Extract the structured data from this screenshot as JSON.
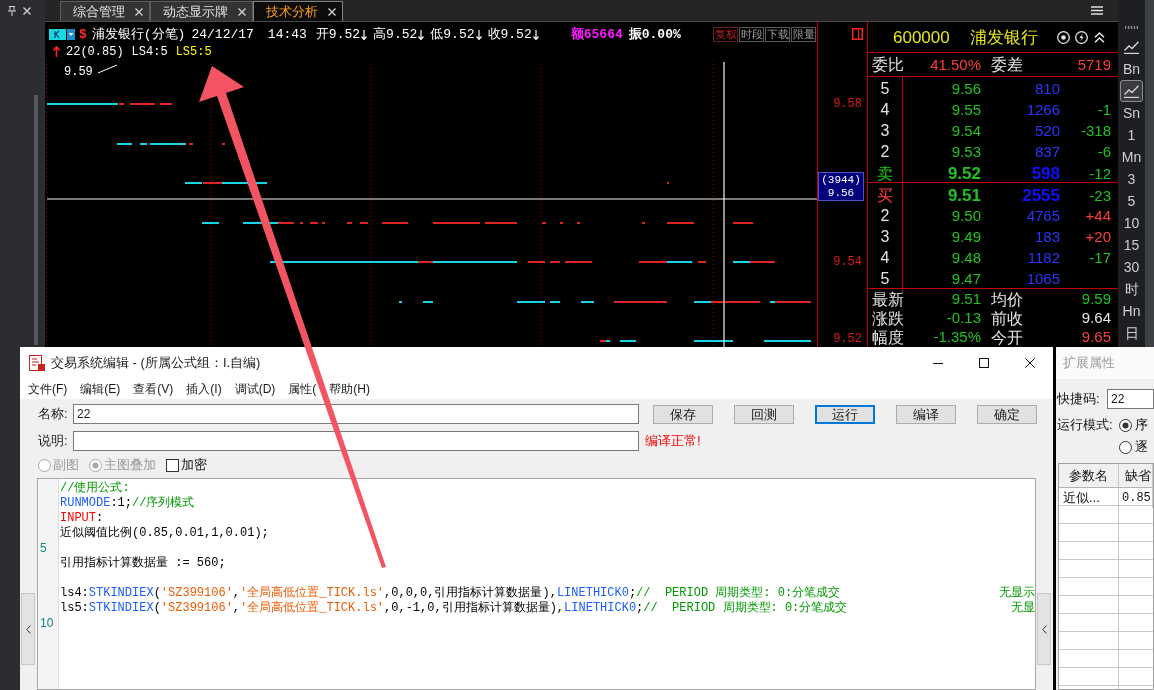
{
  "top_bar": {
    "tabs": [
      {
        "label": "综合管理",
        "selected": false
      },
      {
        "label": "动态显示牌",
        "selected": false
      },
      {
        "label": "技术分析",
        "selected": true
      }
    ]
  },
  "chart": {
    "header": {
      "currency_mark": "$",
      "title": "浦发银行(分笔)",
      "date": "24/12/17",
      "time": "14:43",
      "quotes": [
        {
          "label": "开",
          "value": "9.52"
        },
        {
          "label": "高",
          "value": "9.52"
        },
        {
          "label": "低",
          "value": "9.52"
        },
        {
          "label": "收",
          "value": "9.52"
        }
      ],
      "amount": "额65664",
      "amplitude": "振0.00%",
      "buttons": [
        {
          "label": "复权",
          "selected": true
        },
        {
          "label": "时段",
          "selected": false
        },
        {
          "label": "下载",
          "selected": false
        },
        {
          "label": "限量",
          "selected": false
        }
      ]
    },
    "indicators": [
      {
        "text": "22(0.85)",
        "color": "#ffffff"
      },
      {
        "text": "LS4:5",
        "color": "#ffffff"
      },
      {
        "text": "LS5:5",
        "color": "#ffff00"
      }
    ],
    "top_price": "9.59",
    "axis_labels": [
      "9.58",
      "9.54",
      "9.52"
    ],
    "cursor": {
      "count": "(3944)",
      "price": "9.56"
    }
  },
  "quote_panel": {
    "code": "600000",
    "name": "浦发银行",
    "ratio_label": "委比",
    "ratio": "41.50%",
    "diff_label": "委差",
    "diff": "5719",
    "asks": [
      {
        "level": "5",
        "price": "9.56",
        "volume": "810",
        "best": false
      },
      {
        "level": "4",
        "price": "9.55",
        "volume": "1266",
        "change": "-1",
        "rising": false,
        "best": false
      },
      {
        "level": "3",
        "price": "9.54",
        "volume": "520",
        "change": "-318",
        "rising": false,
        "best": false
      },
      {
        "level": "2",
        "price": "9.53",
        "volume": "837",
        "change": "-6",
        "rising": false,
        "best": false
      },
      {
        "level": "卖",
        "price": "9.52",
        "volume": "598",
        "change": "-12",
        "rising": false,
        "best": true
      }
    ],
    "bids": [
      {
        "level": "买",
        "price": "9.51",
        "volume": "2555",
        "change": "-23",
        "rising": false,
        "best": true
      },
      {
        "level": "2",
        "price": "9.50",
        "volume": "4765",
        "change": "+44",
        "rising": true,
        "best": false
      },
      {
        "level": "3",
        "price": "9.49",
        "volume": "183",
        "change": "+20",
        "rising": true,
        "best": false
      },
      {
        "level": "4",
        "price": "9.48",
        "volume": "1182",
        "change": "-17",
        "rising": false,
        "best": false
      },
      {
        "level": "5",
        "price": "9.47",
        "volume": "1065",
        "best": false
      }
    ],
    "stats": [
      {
        "label": "最新",
        "value": "9.51",
        "color": "#1fc41f"
      },
      {
        "label": "均价",
        "value": "9.59",
        "color": "#1fc41f"
      },
      {
        "label": "涨跌",
        "value": "-0.13",
        "color": "#1fc41f"
      },
      {
        "label": "前收",
        "value": "9.64",
        "color": "#e4e4e4"
      },
      {
        "label": "幅度",
        "value": "-1.35%",
        "color": "#1fc41f"
      },
      {
        "label": "今开",
        "value": "9.65",
        "color": "#ff3c3c"
      }
    ]
  },
  "period_toolbar": {
    "items": [
      {
        "kind": "icon",
        "selected": false
      },
      {
        "kind": "text",
        "label": "Bn",
        "selected": false
      },
      {
        "kind": "icon",
        "selected": true
      },
      {
        "kind": "text",
        "label": "Sn",
        "selected": false
      },
      {
        "kind": "text",
        "label": "1",
        "selected": false
      },
      {
        "kind": "text",
        "label": "Mn",
        "selected": false
      },
      {
        "kind": "text",
        "label": "3",
        "selected": false
      },
      {
        "kind": "text",
        "label": "5",
        "selected": false
      },
      {
        "kind": "text",
        "label": "10",
        "selected": false
      },
      {
        "kind": "text",
        "label": "15",
        "selected": false
      },
      {
        "kind": "text",
        "label": "30",
        "selected": false
      },
      {
        "kind": "text",
        "label": "时",
        "selected": false
      },
      {
        "kind": "text",
        "label": "Hn",
        "selected": false
      },
      {
        "kind": "text",
        "label": "日",
        "selected": false
      }
    ]
  },
  "formula_editor": {
    "title": "交易系统编辑 - (所属公式组：I.自编)",
    "menu": [
      "文件(F)",
      "编辑(E)",
      "查看(V)",
      "插入(I)",
      "调试(D)",
      "属性(",
      "帮助(H)"
    ],
    "name_label": "名称:",
    "name_value": "22",
    "desc_label": "说明:",
    "buttons": [
      {
        "label": "保存",
        "focused": false
      },
      {
        "label": "回测",
        "focused": false
      },
      {
        "label": "运行",
        "focused": true
      },
      {
        "label": "编译",
        "focused": false
      },
      {
        "label": "确定",
        "focused": false
      }
    ],
    "status": "编译正常!",
    "options": [
      {
        "kind": "radio",
        "label": "副图",
        "selected": false,
        "disabled": true
      },
      {
        "kind": "radio",
        "label": "主图叠加",
        "selected": true,
        "disabled": true
      },
      {
        "kind": "checkbox",
        "label": "加密",
        "checked": false,
        "disabled": false
      }
    ],
    "code_lines": [
      {
        "kind": "code",
        "tokens": [
          {
            "kind": "comment",
            "text": "//使用公式:"
          }
        ]
      },
      {
        "kind": "code",
        "tokens": [
          {
            "kind": "keyword",
            "text": "RUNMODE"
          },
          {
            "kind": "text",
            "text": ":1;"
          },
          {
            "kind": "comment",
            "text": "//序列模式"
          }
        ]
      },
      {
        "kind": "code",
        "tokens": [
          {
            "kind": "declaration",
            "text": "INPUT"
          },
          {
            "kind": "text",
            "text": ":"
          }
        ]
      },
      {
        "kind": "code",
        "tokens": [
          {
            "kind": "text",
            "text": "近似阈值比例(0.85,0.01,1,0.01);"
          }
        ]
      },
      {
        "kind": "blank",
        "number": "5"
      },
      {
        "kind": "code",
        "tokens": [
          {
            "kind": "text",
            "text": "引用指标计算数据量 := 560;"
          }
        ]
      },
      {
        "kind": "blank"
      },
      {
        "kind": "code",
        "tokens": [
          {
            "kind": "text",
            "text": "ls4:"
          },
          {
            "kind": "keyword",
            "text": "STKINDIEX"
          },
          {
            "kind": "text",
            "text": "("
          },
          {
            "kind": "string",
            "text": "'SZ399106'"
          },
          {
            "kind": "text",
            "text": ","
          },
          {
            "kind": "string",
            "text": "'全局高低位置_TICK.ls'"
          },
          {
            "kind": "text",
            "text": ",0,0,0,引用指标计算数据量),"
          },
          {
            "kind": "keyword",
            "text": "LINETHICK0"
          },
          {
            "kind": "text",
            "text": ";"
          },
          {
            "kind": "comment",
            "text": "//  PERIOD 周期类型: 0:分笔成交"
          }
        ],
        "trailing": "无显示"
      },
      {
        "kind": "code",
        "tokens": [
          {
            "kind": "text",
            "text": "ls5:"
          },
          {
            "kind": "keyword",
            "text": "STKINDIEX"
          },
          {
            "kind": "text",
            "text": "("
          },
          {
            "kind": "string",
            "text": "'SZ399106'"
          },
          {
            "kind": "text",
            "text": ","
          },
          {
            "kind": "string",
            "text": "'全局高低位置_TICK.ls'"
          },
          {
            "kind": "text",
            "text": ",0,-1,0,引用指标计算数据量),"
          },
          {
            "kind": "keyword",
            "text": "LINETHICK0"
          },
          {
            "kind": "text",
            "text": ";"
          },
          {
            "kind": "comment",
            "text": "//  PERIOD 周期类型: 0:分笔成交"
          }
        ],
        "trailing": "无显"
      },
      {
        "kind": "blank",
        "number": "10"
      }
    ]
  },
  "properties_panel": {
    "title": "扩展属性",
    "shortcut_label": "快捷码:",
    "shortcut_value": "22",
    "mode_label": "运行模式:",
    "modes": [
      {
        "label": "序",
        "selected": true
      },
      {
        "label": "逐",
        "selected": false
      }
    ],
    "columns": [
      "参数名",
      "缺省"
    ],
    "rows": [
      [
        "近似...",
        "0.85"
      ]
    ]
  }
}
